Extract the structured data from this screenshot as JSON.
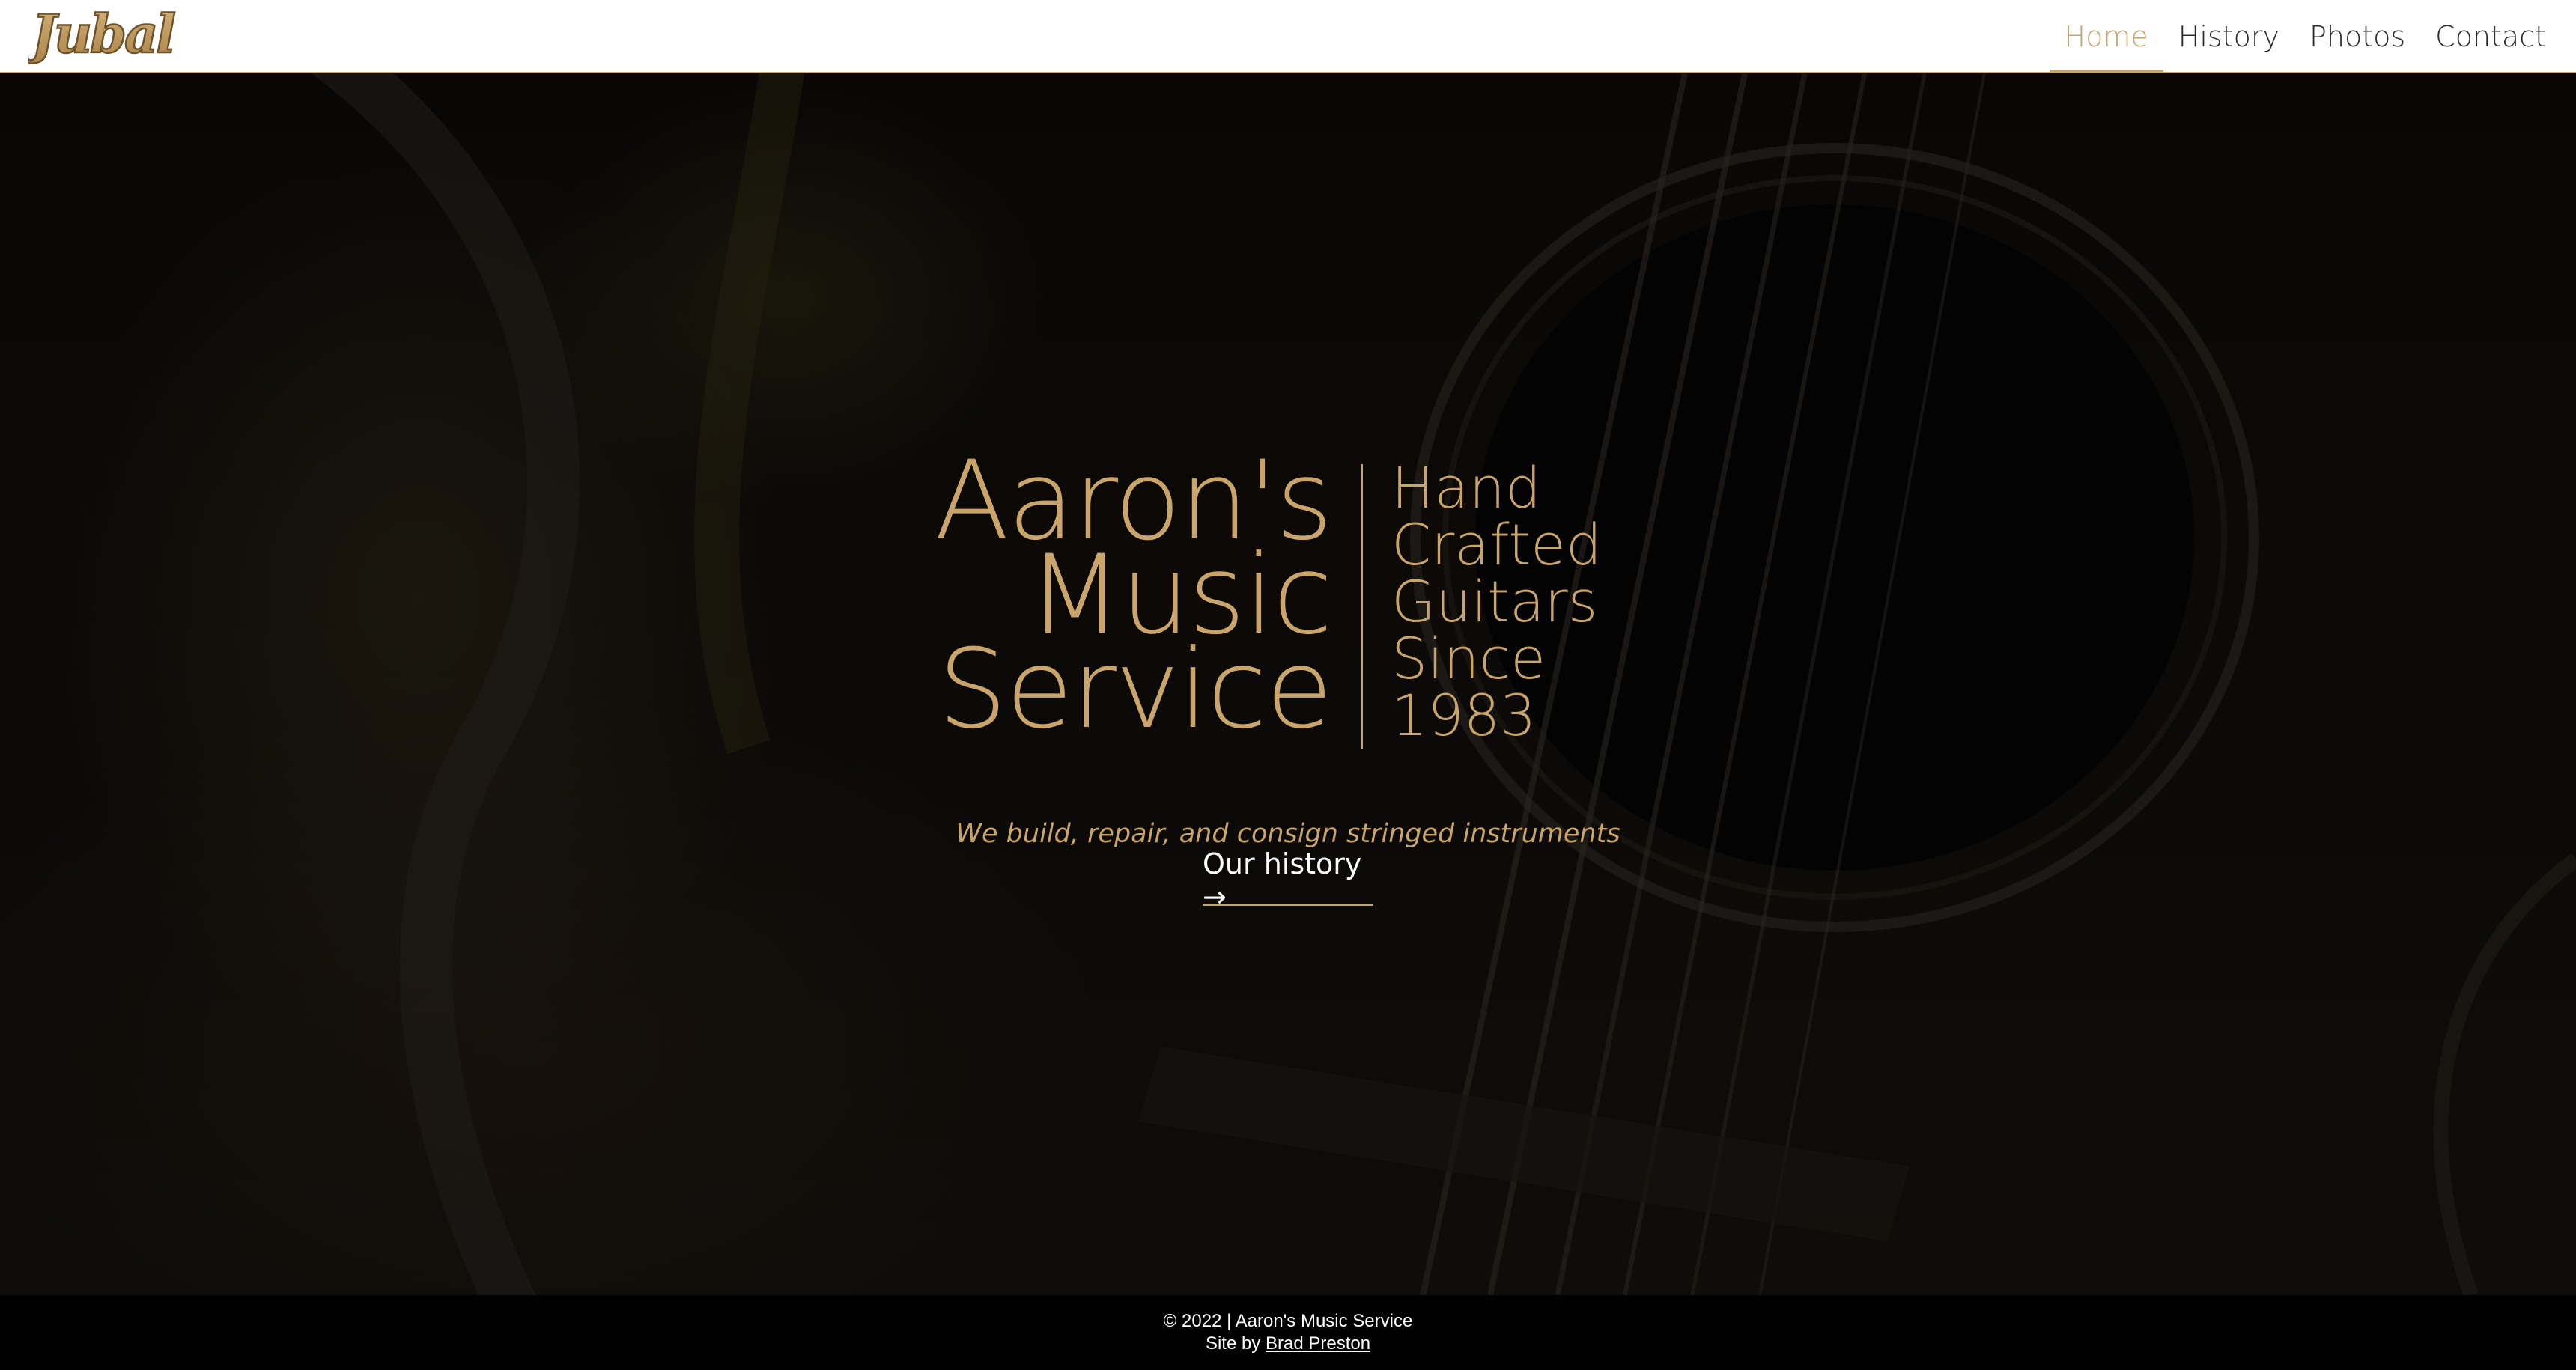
{
  "header": {
    "logo_text": "Jubal",
    "nav": [
      {
        "label": "Home",
        "active": true
      },
      {
        "label": "History",
        "active": false
      },
      {
        "label": "Photos",
        "active": false
      },
      {
        "label": "Contact",
        "active": false
      }
    ]
  },
  "hero": {
    "title_lines": [
      "Aaron's",
      "Music",
      "Service"
    ],
    "subtitle_lines": [
      "Hand",
      "Crafted",
      "Guitars",
      "Since",
      "1983"
    ],
    "tagline": "We build, repair, and consign stringed instruments",
    "cta_label": "Our history →"
  },
  "footer": {
    "copyright": "© 2022 | Aaron's Music Service",
    "credit_prefix": "Site by ",
    "credit_name": "Brad Preston"
  },
  "colors": {
    "accent": "#c9a56b",
    "header_bg": "#ffffff",
    "footer_bg": "#000000",
    "hero_bg": "#0c0a08"
  },
  "icons": {
    "cta_arrow": "right-arrow-icon"
  }
}
